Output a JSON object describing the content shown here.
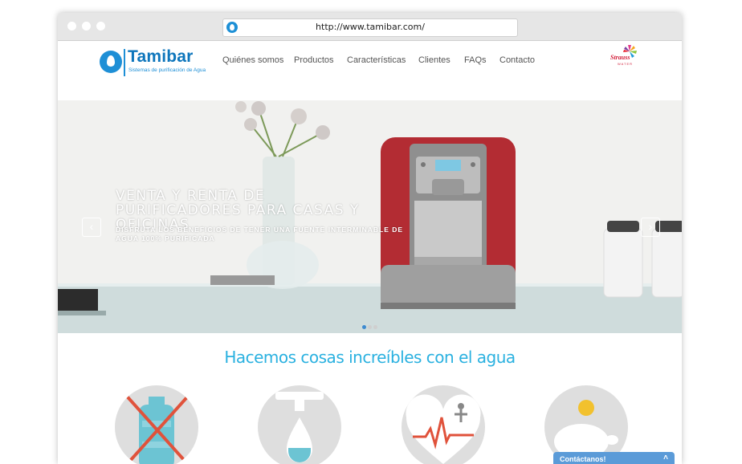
{
  "browser": {
    "url": "http://www.tamibar.com/"
  },
  "site": {
    "logo_name": "Tamibar",
    "logo_tagline": "Sistemas de purificación de Agua",
    "nav": [
      {
        "label": "Quiénes somos"
      },
      {
        "label": "Productos"
      },
      {
        "label": "Características"
      },
      {
        "label": "Clientes"
      },
      {
        "label": "FAQs"
      },
      {
        "label": "Contacto"
      }
    ],
    "partner": {
      "name": "Strauss",
      "sub": "WATER"
    }
  },
  "hero": {
    "title": "VENTA Y RENTA DE PURIFICADORES PARA CASAS Y OFICINAS",
    "subtitle": "DISFRUTA LOS BENEFICIOS DE TENER UNA FUENTE INTERMINABLE DE AGUA 100% PURIFICADA",
    "prev_symbol": "‹",
    "next_symbol": "›",
    "slide_count": 3,
    "active_slide": 1
  },
  "section": {
    "title": "Hacemos cosas increíbles con el agua",
    "features": [
      {
        "icon": "no-bottle-icon"
      },
      {
        "icon": "water-tap-icon"
      },
      {
        "icon": "heart-health-icon"
      },
      {
        "icon": "piggy-bank-icon"
      }
    ]
  },
  "contact": {
    "label": "Contáctanos!",
    "chevron": "˄"
  },
  "colors": {
    "brand_blue": "#0e76bc",
    "accent_cyan": "#2ab1e0",
    "contact_blue": "#5b9bd8",
    "machine_red": "#b32c33",
    "cross_red": "#e0523b"
  }
}
